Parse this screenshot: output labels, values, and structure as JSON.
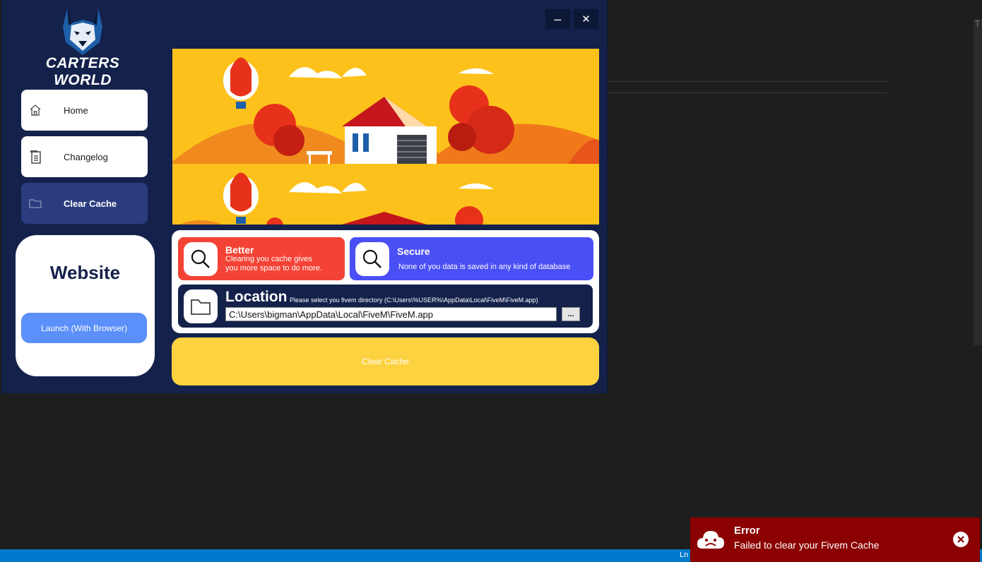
{
  "window": {
    "minimize_label": "–",
    "close_label": "✕"
  },
  "brand": {
    "name": "CARTERS WORLD"
  },
  "nav": {
    "items": [
      {
        "label": "Home",
        "icon": "home-icon"
      },
      {
        "label": "Changelog",
        "icon": "clipboard-icon"
      },
      {
        "label": "Clear Cache",
        "icon": "folder-icon",
        "active": true
      }
    ]
  },
  "website": {
    "title": "Website",
    "launch_label": "Launch (With Browser)"
  },
  "cards": {
    "better": {
      "title": "Better",
      "line1": "Clearing you cache gives",
      "line2": "you more space to do more.",
      "color": "#f44336"
    },
    "secure": {
      "title": "Secure",
      "description": "None of you data is saved in any kind of database",
      "color": "#4a4ff5"
    }
  },
  "location": {
    "title": "Location",
    "hint": "Please select you fivem directory (C:\\Users\\%USER%\\AppData\\Local\\FiveM\\FiveM.app)",
    "value": "C:\\Users\\bigman\\AppData\\Local\\FiveM\\FiveM.app",
    "browse_label": "..."
  },
  "clear_button": {
    "label": "Clear Cache",
    "color": "#fdd240"
  },
  "toast": {
    "title": "Error",
    "message": "Failed to clear your Fivem Cache",
    "color": "#8b0000"
  },
  "statusbar": {
    "text": "Ln",
    "color": "#007acc"
  },
  "colors": {
    "app_bg": "#14214b",
    "active_nav": "#2a3c7e",
    "launch_button": "#5b8ff9"
  }
}
